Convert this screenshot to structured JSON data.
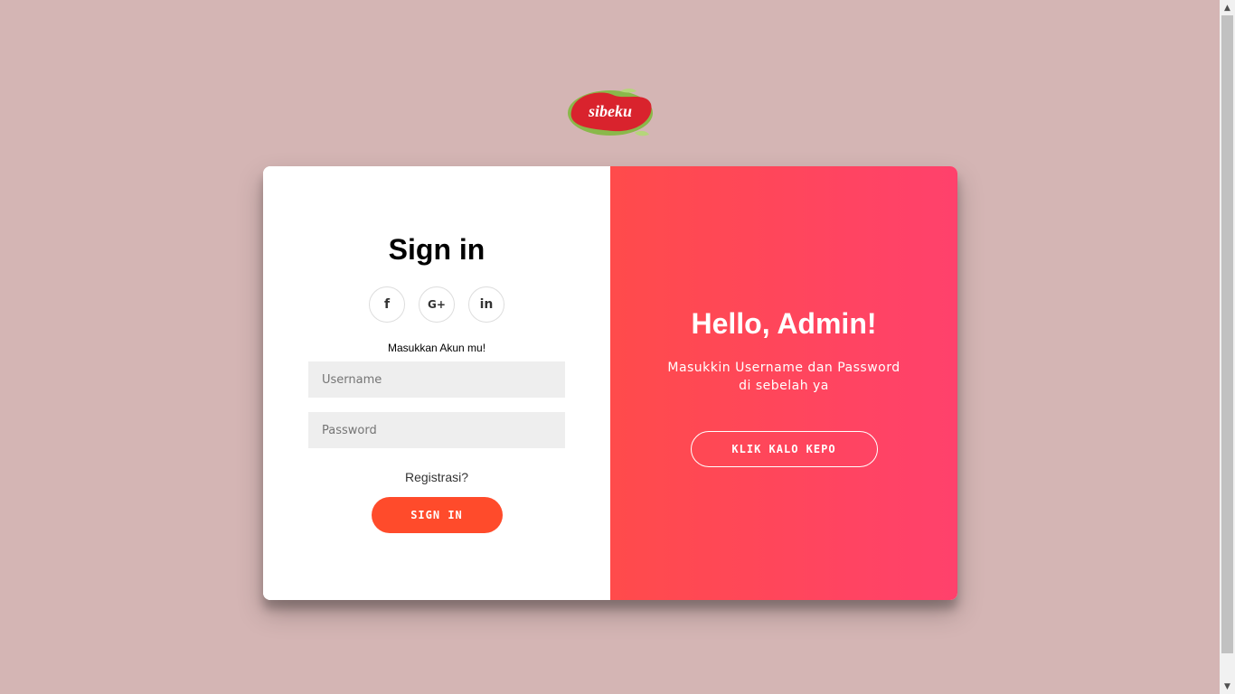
{
  "logo": {
    "text": "sibeku",
    "colors": {
      "red": "#d9232d",
      "green": "#8ab84a"
    }
  },
  "signin": {
    "title": "Sign in",
    "social": [
      {
        "icon": "facebook-icon",
        "glyph": "f"
      },
      {
        "icon": "google-plus-icon",
        "glyph": "G+"
      },
      {
        "icon": "linkedin-icon",
        "glyph": "in"
      }
    ],
    "instruction": "Masukkan Akun mu!",
    "username_placeholder": "Username",
    "password_placeholder": "Password",
    "register_label": "Registrasi?",
    "button_label": "SIGN IN"
  },
  "overlay": {
    "title": "Hello, Admin!",
    "text": "Masukkin Username dan Password di sebelah ya",
    "button_label": "KLIK KALO KEPO"
  },
  "colors": {
    "background": "#d4b5b4",
    "accent": "#ff4b2b",
    "gradient_start": "#ff4b4b",
    "gradient_end": "#ff416c"
  },
  "scrollbar": {
    "up_arrow": "▲",
    "down_arrow": "▼"
  }
}
